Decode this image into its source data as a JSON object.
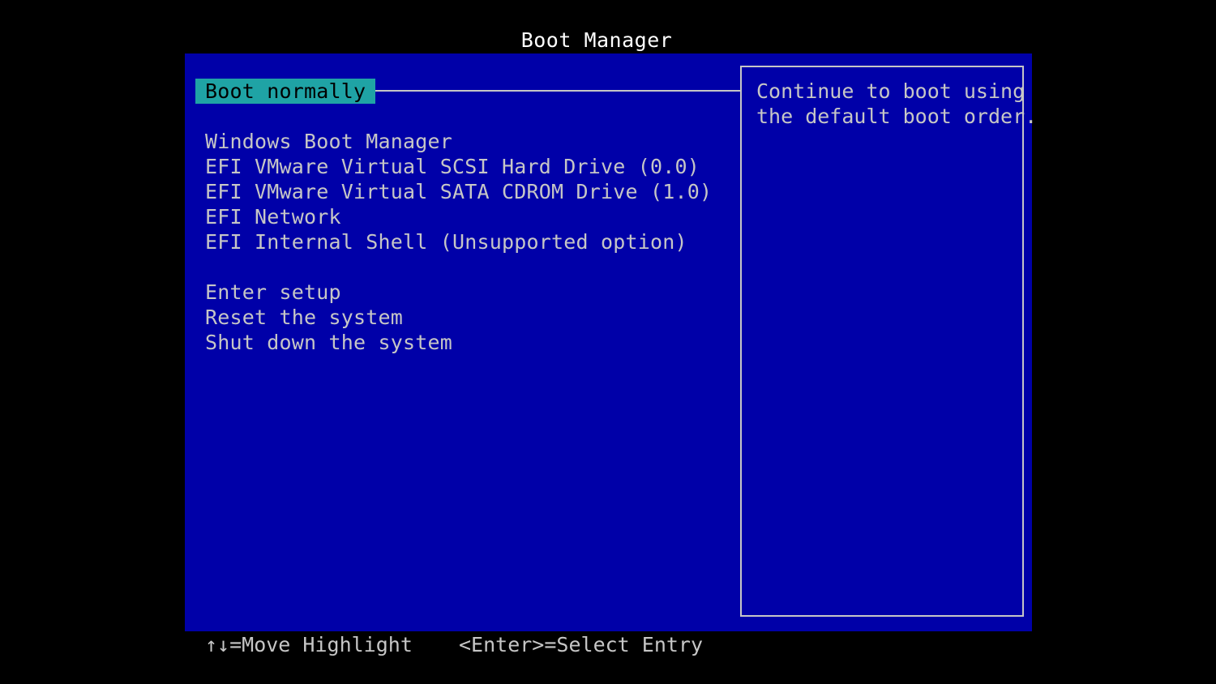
{
  "title": "Boot Manager",
  "menu": {
    "selected_index": 0,
    "items": [
      {
        "label": "Boot normally"
      },
      {
        "label": "Windows Boot Manager"
      },
      {
        "label": "EFI VMware Virtual SCSI Hard Drive (0.0)"
      },
      {
        "label": "EFI VMware Virtual SATA CDROM Drive (1.0)"
      },
      {
        "label": "EFI Network"
      },
      {
        "label": "EFI Internal Shell (Unsupported option)"
      },
      {
        "label": "Enter setup"
      },
      {
        "label": "Reset the system"
      },
      {
        "label": "Shut down the system"
      }
    ]
  },
  "help": {
    "lines": [
      "Continue to boot using",
      "the default boot order."
    ]
  },
  "footer": {
    "move_hint": "↑↓=Move Highlight",
    "select_hint": "<Enter>=Select Entry"
  },
  "colors": {
    "panel_background": "#0000a8",
    "highlight_background": "#1fa3a5",
    "text": "#c6c6c6",
    "title_text": "#ffffff",
    "screen_background": "#000000"
  }
}
